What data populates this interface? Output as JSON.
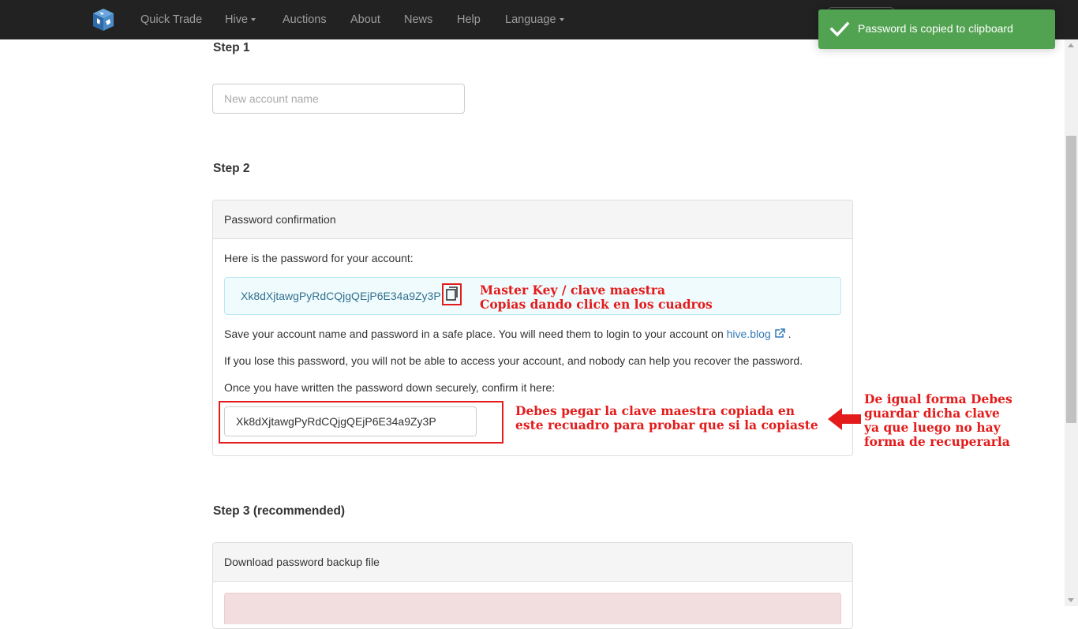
{
  "navbar": {
    "logo": "hive-logo-icon",
    "items": [
      {
        "label": "Quick Trade",
        "dropdown": false
      },
      {
        "label": "Hive",
        "dropdown": true
      },
      {
        "label": "Auctions",
        "dropdown": false
      },
      {
        "label": "About",
        "dropdown": false
      },
      {
        "label": "News",
        "dropdown": false
      },
      {
        "label": "Help",
        "dropdown": false
      },
      {
        "label": "Language",
        "dropdown": true
      }
    ]
  },
  "toast": {
    "icon": "checkmark-icon",
    "message": "Password is copied to clipboard",
    "color": "#51a351"
  },
  "step1": {
    "title": "Step 1",
    "account_placeholder": "New account name"
  },
  "step2": {
    "title": "Step 2",
    "panel_heading": "Password confirmation",
    "intro": "Here is the password for your account:",
    "password": "Xk8dXjtawgPyRdCQjgQEjP6E34a9Zy3P",
    "copy_icon": "copy-icon",
    "save_note_prefix": "Save your account name and password in a safe place. You will need them to login to your account on",
    "save_note_link": "hive.blog",
    "save_note_suffix": ".",
    "lose_note": "If you lose this password, you will not be able to access your account, and nobody can help you recover the password.",
    "confirm_prompt": "Once you have written the password down securely, confirm it here:",
    "confirm_value": "Xk8dXjtawgPyRdCQjgQEjP6E34a9Zy3P"
  },
  "step3": {
    "title": "Step 3 (recommended)",
    "panel_heading": "Download password backup file"
  },
  "annotations": {
    "color": "#e31b1b",
    "master_key_line1": "Master Key / clave maestra",
    "master_key_line2": "Copias dando click en los cuadros",
    "paste_line1": "Debes pegar la clave maestra copiada en",
    "paste_line2": "este recuadro para probar que si la copiaste",
    "save_line1": "De igual forma Debes",
    "save_line2": "guardar dicha clave",
    "save_line3": "ya que luego no hay",
    "save_line4": "forma de recuperarla"
  }
}
